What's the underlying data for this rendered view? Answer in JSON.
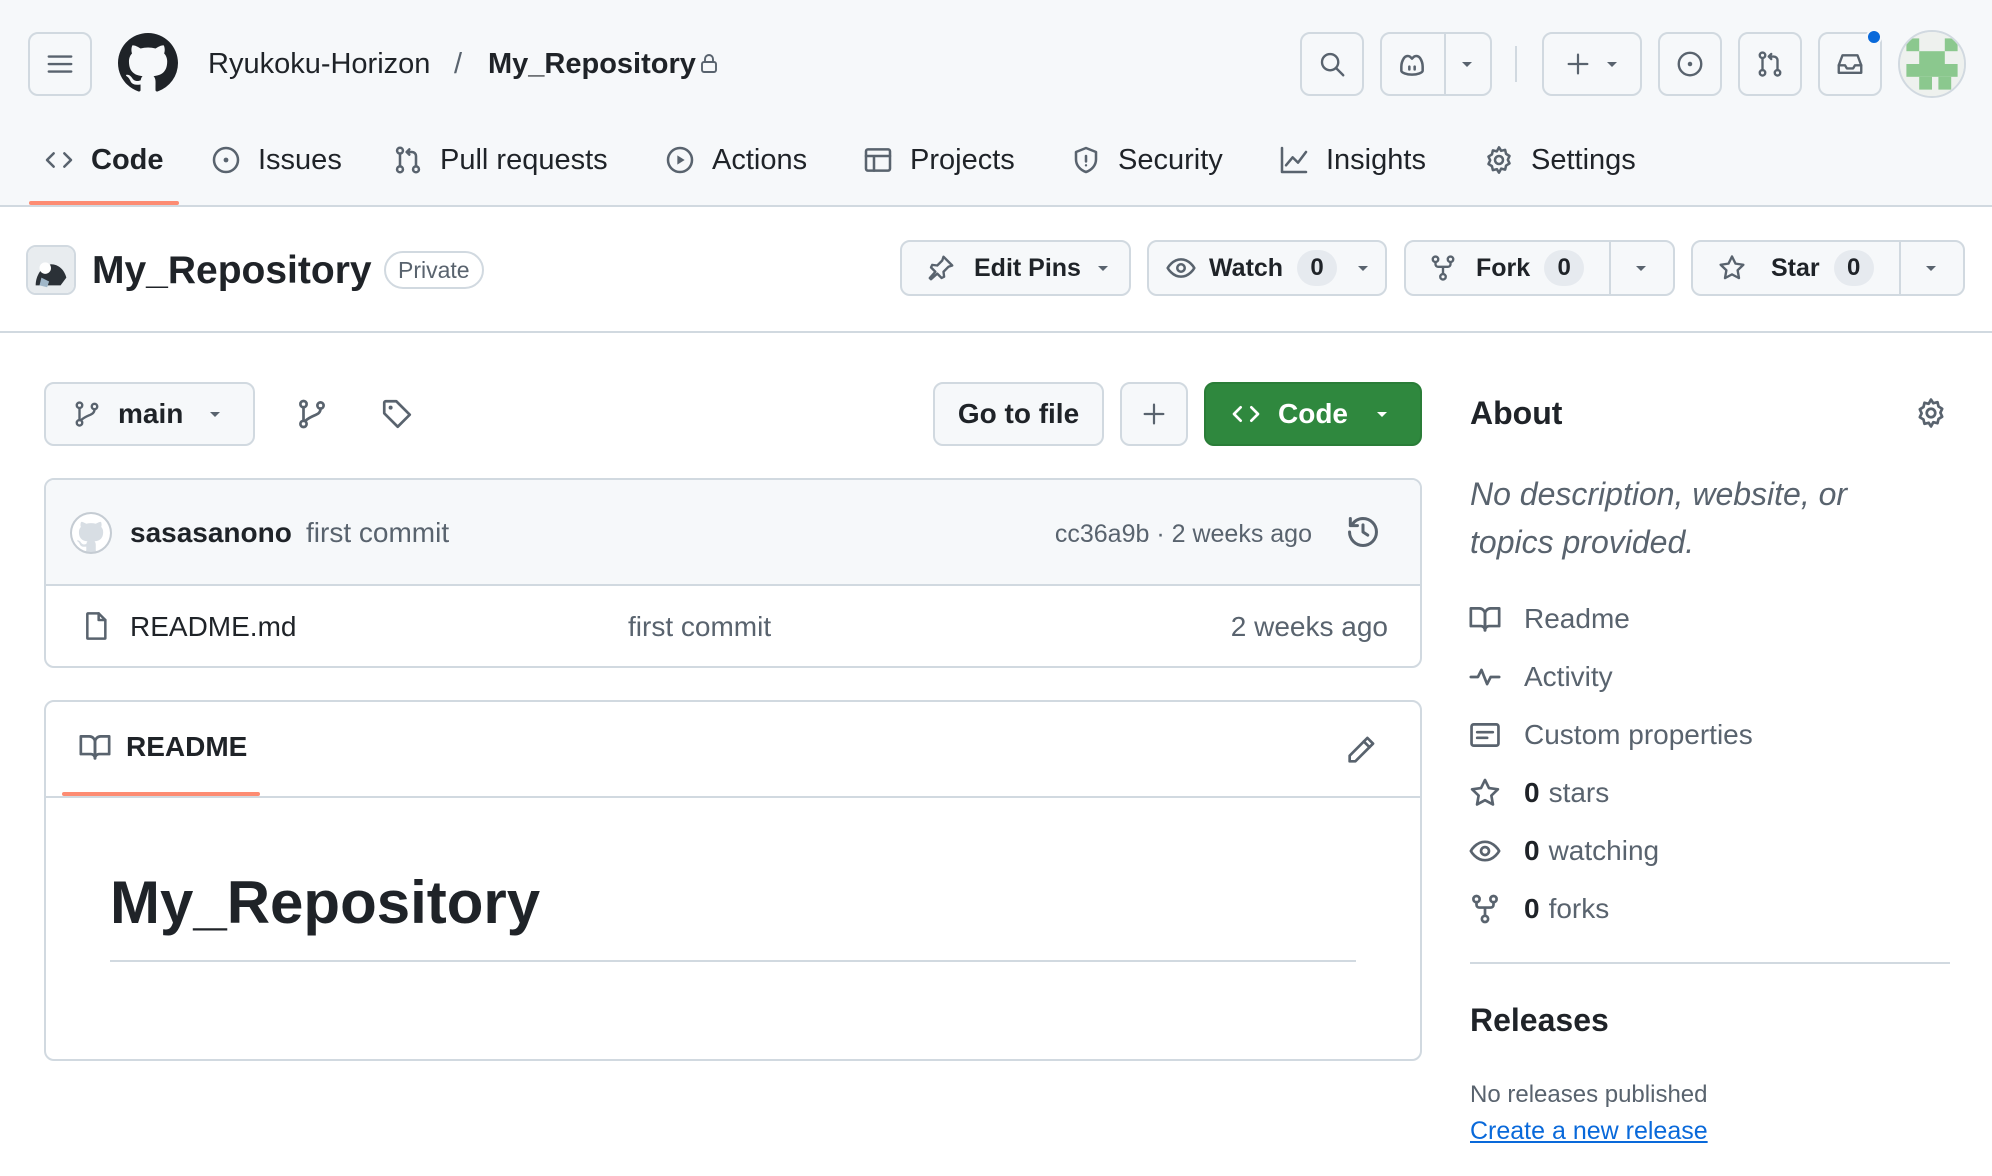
{
  "header": {
    "owner": "Ryukoku-Horizon",
    "separator": "/",
    "repo": "My_Repository"
  },
  "tabs": [
    {
      "label": "Code",
      "icon": "code-icon",
      "selected": true
    },
    {
      "label": "Issues",
      "icon": "issue-opened-icon"
    },
    {
      "label": "Pull requests",
      "icon": "git-pull-request-icon"
    },
    {
      "label": "Actions",
      "icon": "play-icon"
    },
    {
      "label": "Projects",
      "icon": "table-icon"
    },
    {
      "label": "Security",
      "icon": "shield-icon"
    },
    {
      "label": "Insights",
      "icon": "graph-icon"
    },
    {
      "label": "Settings",
      "icon": "gear-icon"
    }
  ],
  "repo_header": {
    "name": "My_Repository",
    "visibility": "Private",
    "edit_pins_label": "Edit Pins",
    "watch_label": "Watch",
    "watch_count": "0",
    "fork_label": "Fork",
    "fork_count": "0",
    "star_label": "Star",
    "star_count": "0"
  },
  "toolbar": {
    "branch": "main",
    "go_to_file": "Go to file",
    "code_button": "Code"
  },
  "latest_commit": {
    "author": "sasasanono",
    "message": "first commit",
    "hash": "cc36a9b",
    "dot": "·",
    "time": "2 weeks ago"
  },
  "files": [
    {
      "name": "README.md",
      "commit_message": "first commit",
      "time": "2 weeks ago",
      "icon": "file-icon"
    }
  ],
  "readme": {
    "tab_label": "README",
    "heading": "My_Repository"
  },
  "about": {
    "title": "About",
    "description": "No description, website, or topics provided.",
    "links": [
      {
        "label": "Readme",
        "icon": "book-icon"
      },
      {
        "label": "Activity",
        "icon": "pulse-icon"
      },
      {
        "label": "Custom properties",
        "icon": "note-icon"
      }
    ],
    "stats": [
      {
        "count": "0",
        "label": "stars",
        "icon": "star-icon"
      },
      {
        "count": "0",
        "label": "watching",
        "icon": "eye-icon"
      },
      {
        "count": "0",
        "label": "forks",
        "icon": "repo-forked-icon"
      }
    ]
  },
  "releases": {
    "title": "Releases",
    "empty_text": "No releases published",
    "create_link": "Create a new release"
  },
  "colors": {
    "primary_button": "#2f883e",
    "link": "#0969da",
    "selected_tab_underline": "#fd8c73",
    "notification_dot": "#0969da"
  }
}
